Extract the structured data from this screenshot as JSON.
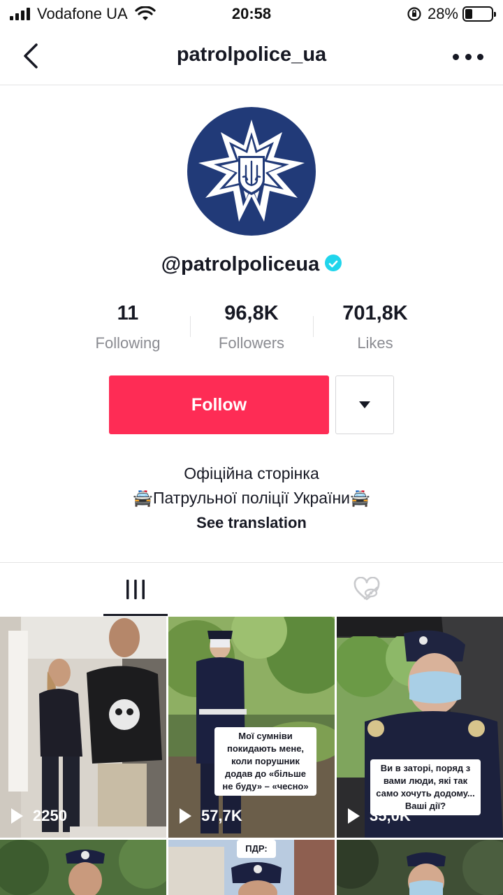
{
  "status_bar": {
    "carrier": "Vodafone UA",
    "time": "20:58",
    "battery_percent": "28%",
    "battery_level": 0.28
  },
  "nav": {
    "title": "patrolpolice_ua"
  },
  "profile": {
    "username": "@patrolpoliceua",
    "verified": true,
    "stats": [
      {
        "value": "11",
        "label": "Following"
      },
      {
        "value": "96,8K",
        "label": "Followers"
      },
      {
        "value": "701,8K",
        "label": "Likes"
      }
    ],
    "follow_label": "Follow",
    "bio_line1": "Офіційна сторінка",
    "bio_line2": "🚔Патрульної поліції України🚔",
    "see_translation": "See translation"
  },
  "tabs": [
    {
      "name": "videos",
      "icon": "grid-icon",
      "active": true
    },
    {
      "name": "liked",
      "icon": "heart-hidden-icon",
      "active": false
    }
  ],
  "videos": [
    {
      "views": "2250",
      "caption": ""
    },
    {
      "views": "57,7K",
      "caption": "Мої сумніви покидають мене, коли порушник додав до «більше не буду» – «чесно»"
    },
    {
      "views": "35,0K",
      "caption": "Ви в заторі, поряд з вами люди, які так само хочуть додому... Ваші дії?"
    },
    {
      "views": "",
      "caption": ""
    },
    {
      "views": "",
      "caption": "ПДР:"
    },
    {
      "views": "",
      "caption": ""
    }
  ],
  "colors": {
    "accent": "#fe2c55",
    "verified": "#20d5ec",
    "avatar_bg": "#213a78"
  }
}
